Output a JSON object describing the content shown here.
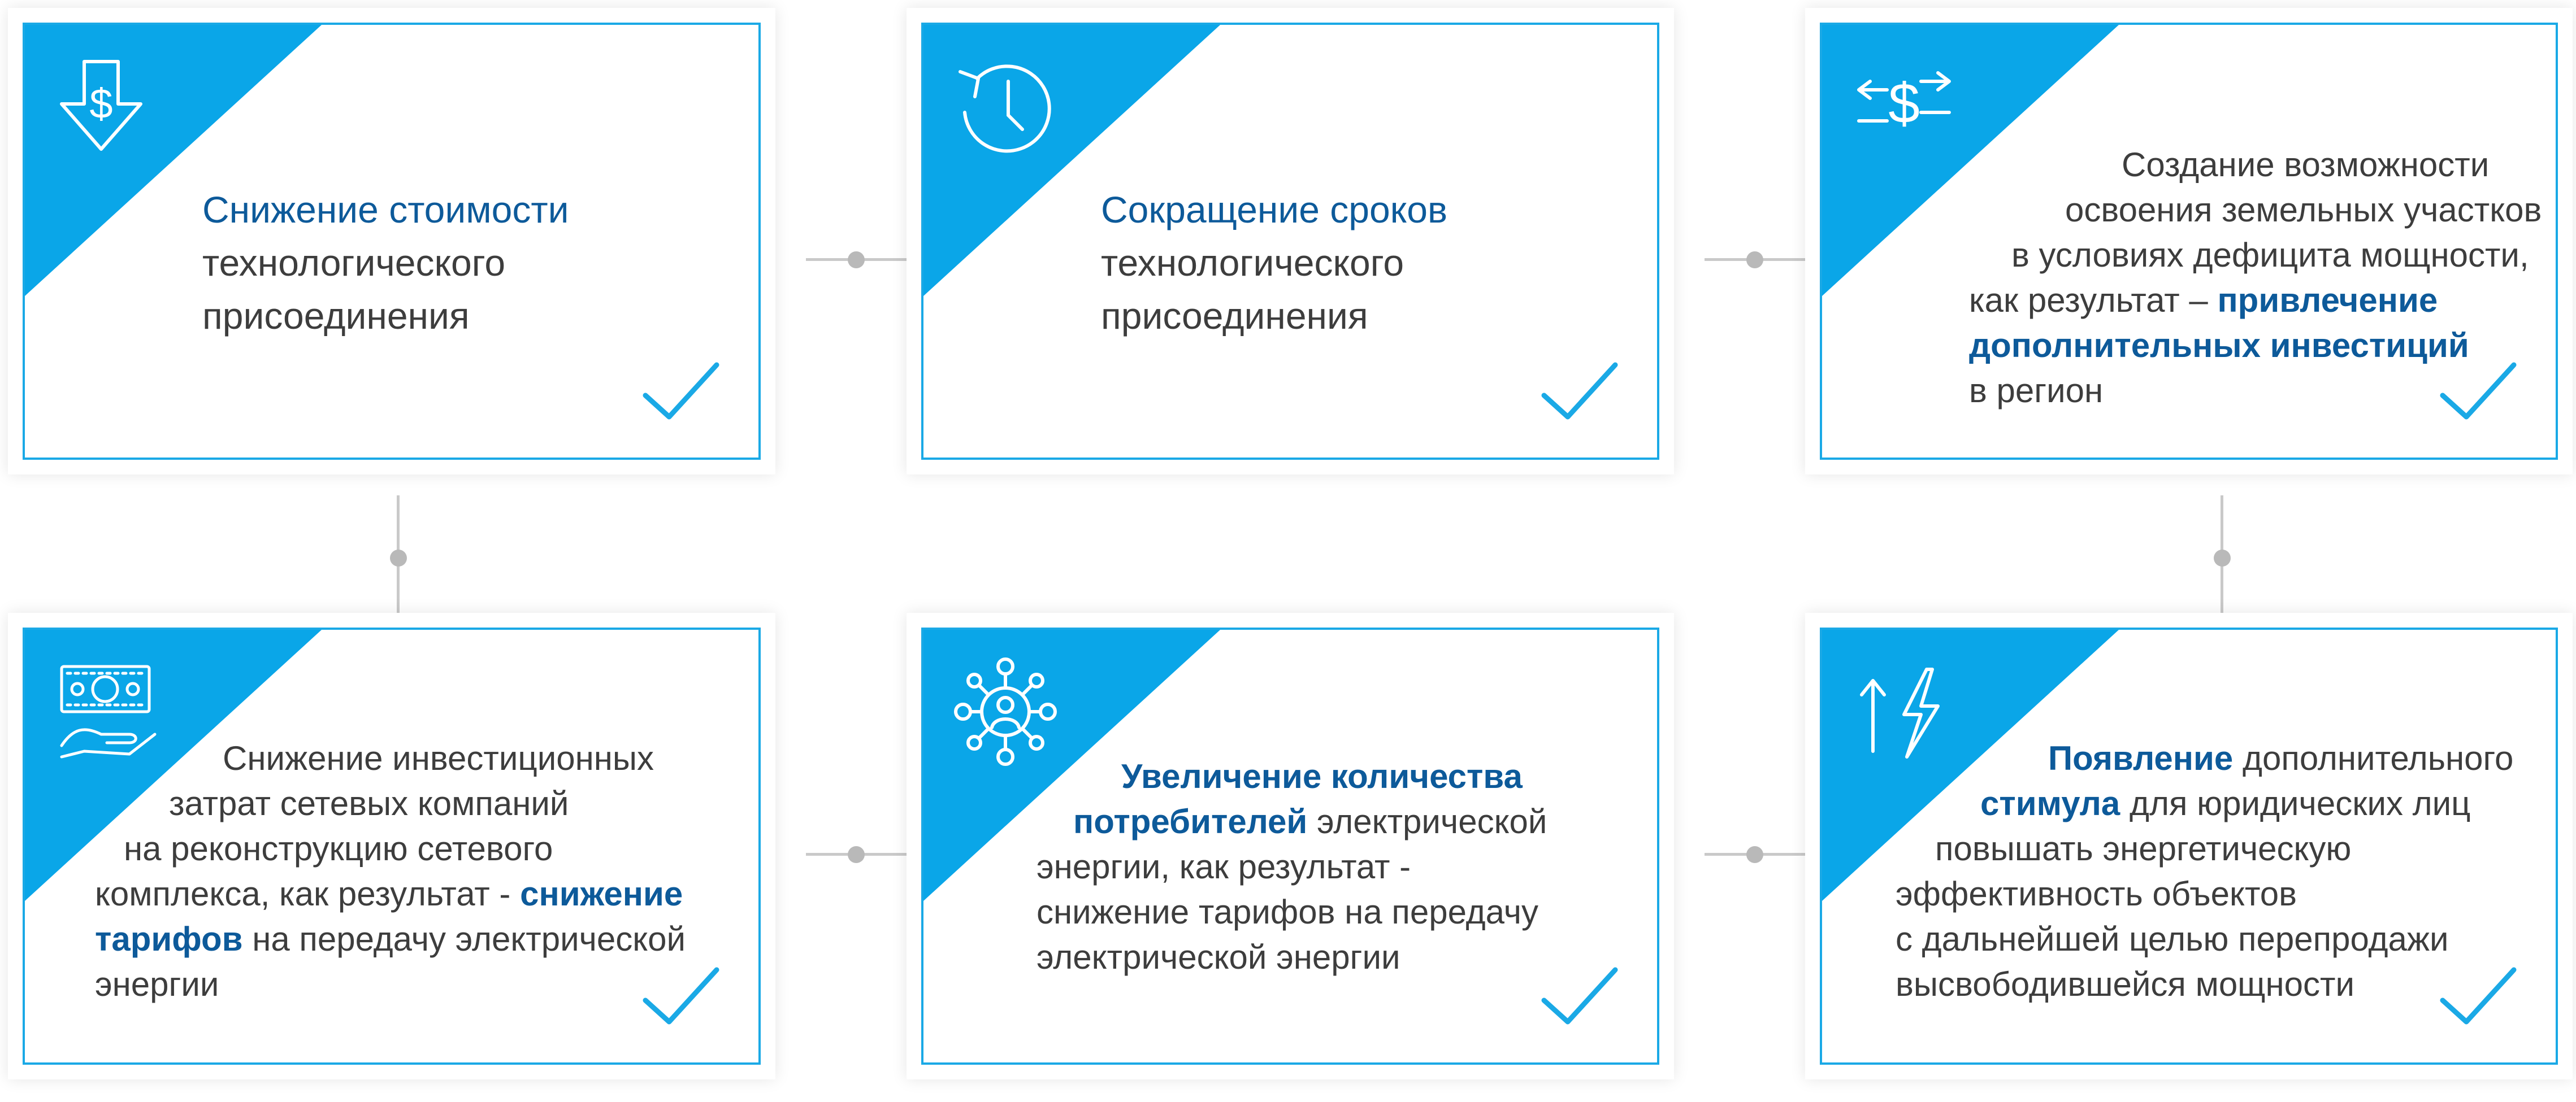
{
  "cards": [
    {
      "icon": "dollar-down-arrow-icon",
      "highlight": "Снижение стоимости",
      "lines": [
        "технологического",
        "присоединения"
      ]
    },
    {
      "icon": "clock-history-icon",
      "highlight": "Сокращение сроков",
      "lines": [
        "технологического",
        "присоединения"
      ]
    },
    {
      "icon": "dollar-exchange-arrows-icon",
      "lines": [
        "Создание возможности",
        "освоения земельных участков",
        "в условиях дефицита мощности,",
        "как результат –"
      ],
      "highlight": "привлечение",
      "highlight2": "дополнительных инвестиций",
      "tail": "в регион"
    },
    {
      "icon": "banknote-hand-icon",
      "lines": [
        "Снижение инвестиционных",
        "затрат сетевых компаний",
        "на реконструкцию сетевого",
        "комплекса, как результат -"
      ],
      "highlight": "снижение",
      "highlight2": "тарифов",
      "tail": "на передачу электрической",
      "tail2": "энергии"
    },
    {
      "icon": "network-user-icon",
      "highlight": "Увеличение количества",
      "highlight2": "потребителей",
      "after2": "электрической",
      "lines": [
        "энергии, как результат -",
        "снижение тарифов на передачу",
        "электрической энергии"
      ]
    },
    {
      "icon": "arrow-up-lightning-icon",
      "highlight": "Появление",
      "after1": "дополнительного",
      "highlight2": "стимула",
      "after2": "для юридических лиц",
      "lines": [
        "повышать энергетическую",
        "эффективность объектов",
        "с дальнейшей целью перепродажи",
        "высвободившейся мощности"
      ]
    }
  ]
}
